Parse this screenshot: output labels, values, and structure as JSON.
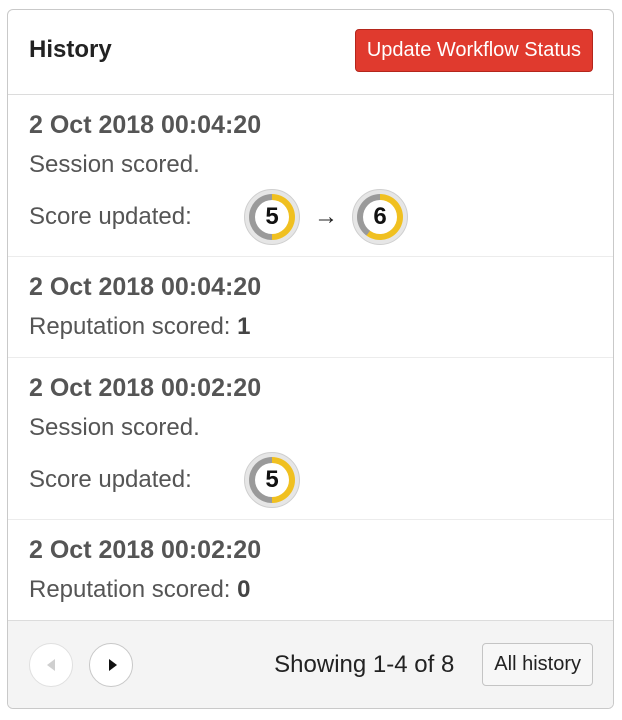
{
  "header": {
    "title": "History",
    "update_button": "Update Workflow Status"
  },
  "entries": [
    {
      "time": "2 Oct 2018 00:04:20",
      "text": "Session scored.",
      "score_label": "Score updated:",
      "score_from": "5",
      "score_to": "6",
      "arrow": "→"
    },
    {
      "time": "2 Oct 2018 00:04:20",
      "text_prefix": "Reputation scored: ",
      "text_value": "1"
    },
    {
      "time": "2 Oct 2018 00:02:20",
      "text": "Session scored.",
      "score_label": "Score updated:",
      "score_value": "5"
    },
    {
      "time": "2 Oct 2018 00:02:20",
      "text_prefix": "Reputation scored: ",
      "text_value": "0"
    }
  ],
  "score_colors": {
    "filled": "#f0c020",
    "empty": "#9a9a9a"
  },
  "score_max": 10,
  "footer": {
    "showing": "Showing 1-4 of 8",
    "all_history": "All history",
    "prev_icon": "chevron-left-icon",
    "next_icon": "chevron-right-icon"
  },
  "colors": {
    "accent": "#e03a2e"
  }
}
